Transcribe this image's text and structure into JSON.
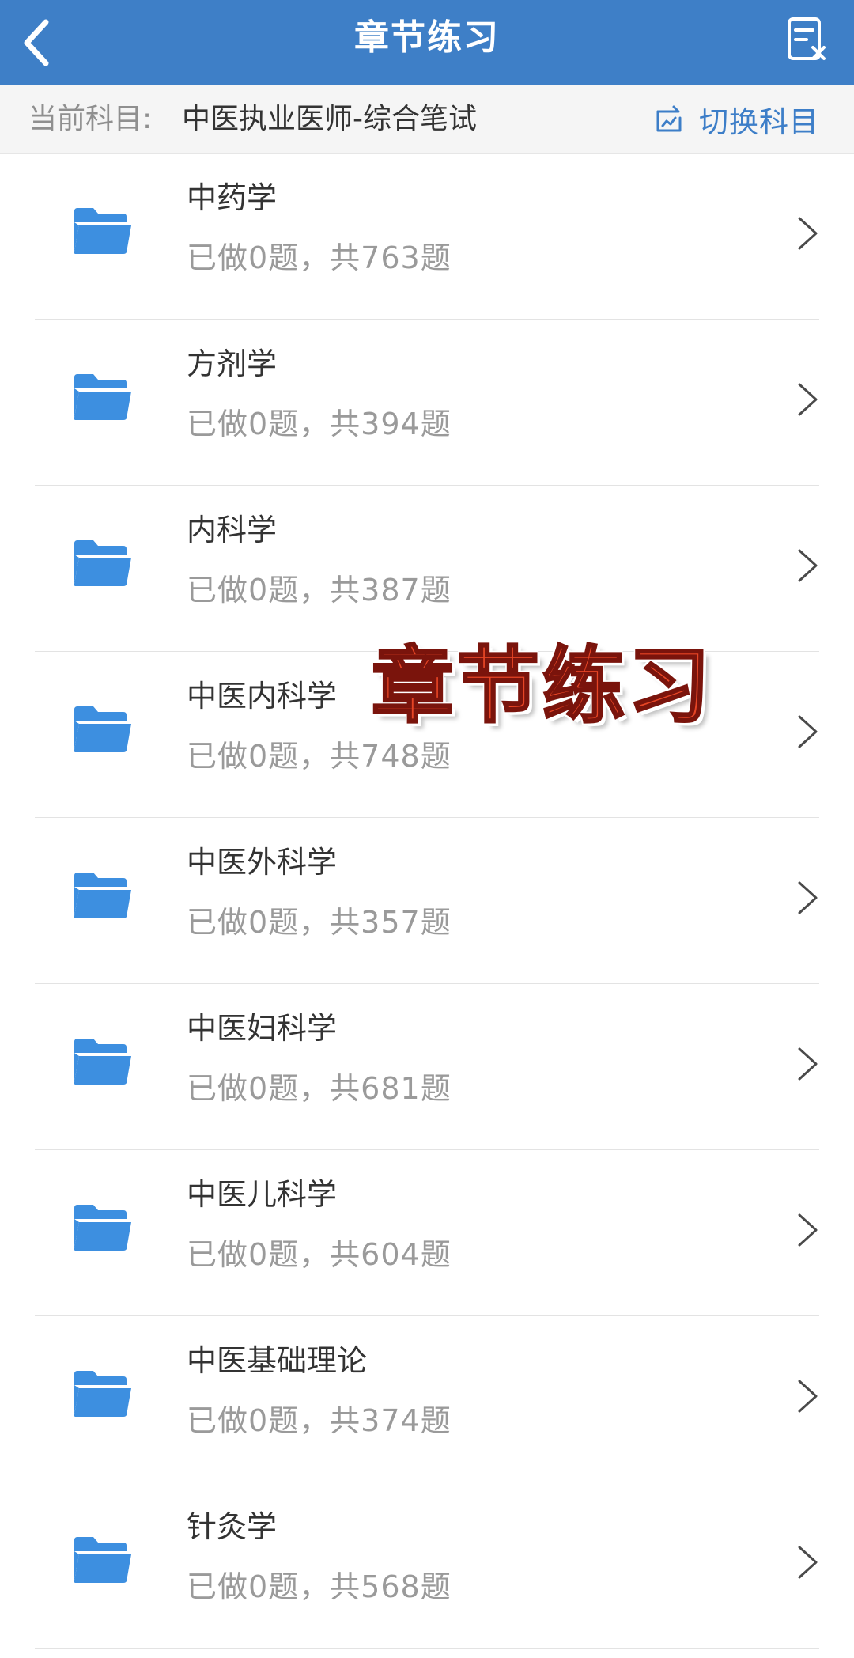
{
  "header": {
    "title": "章节练习",
    "back_icon": "back-chevron-icon",
    "action_icon": "clear-record-icon"
  },
  "subject_bar": {
    "label": "当前科目:",
    "value": "中医执业医师-综合笔试",
    "switch_label": "切换科目",
    "switch_icon": "switch-subject-icon"
  },
  "chapters": [
    {
      "name": "中药学",
      "progress": "已做0题，共763题"
    },
    {
      "name": "方剂学",
      "progress": "已做0题，共394题"
    },
    {
      "name": "内科学",
      "progress": "已做0题，共387题"
    },
    {
      "name": "中医内科学",
      "progress": "已做0题，共748题"
    },
    {
      "name": "中医外科学",
      "progress": "已做0题，共357题"
    },
    {
      "name": "中医妇科学",
      "progress": "已做0题，共681题"
    },
    {
      "name": "中医儿科学",
      "progress": "已做0题，共604题"
    },
    {
      "name": "中医基础理论",
      "progress": "已做0题，共374题"
    },
    {
      "name": "针灸学",
      "progress": "已做0题，共568题"
    }
  ],
  "overlay": {
    "text": "章节练习",
    "color": "#e64525"
  },
  "colors": {
    "header_bg": "#3e7fc7",
    "folder": "#3d8fe0",
    "accent": "#3d7ec8"
  }
}
